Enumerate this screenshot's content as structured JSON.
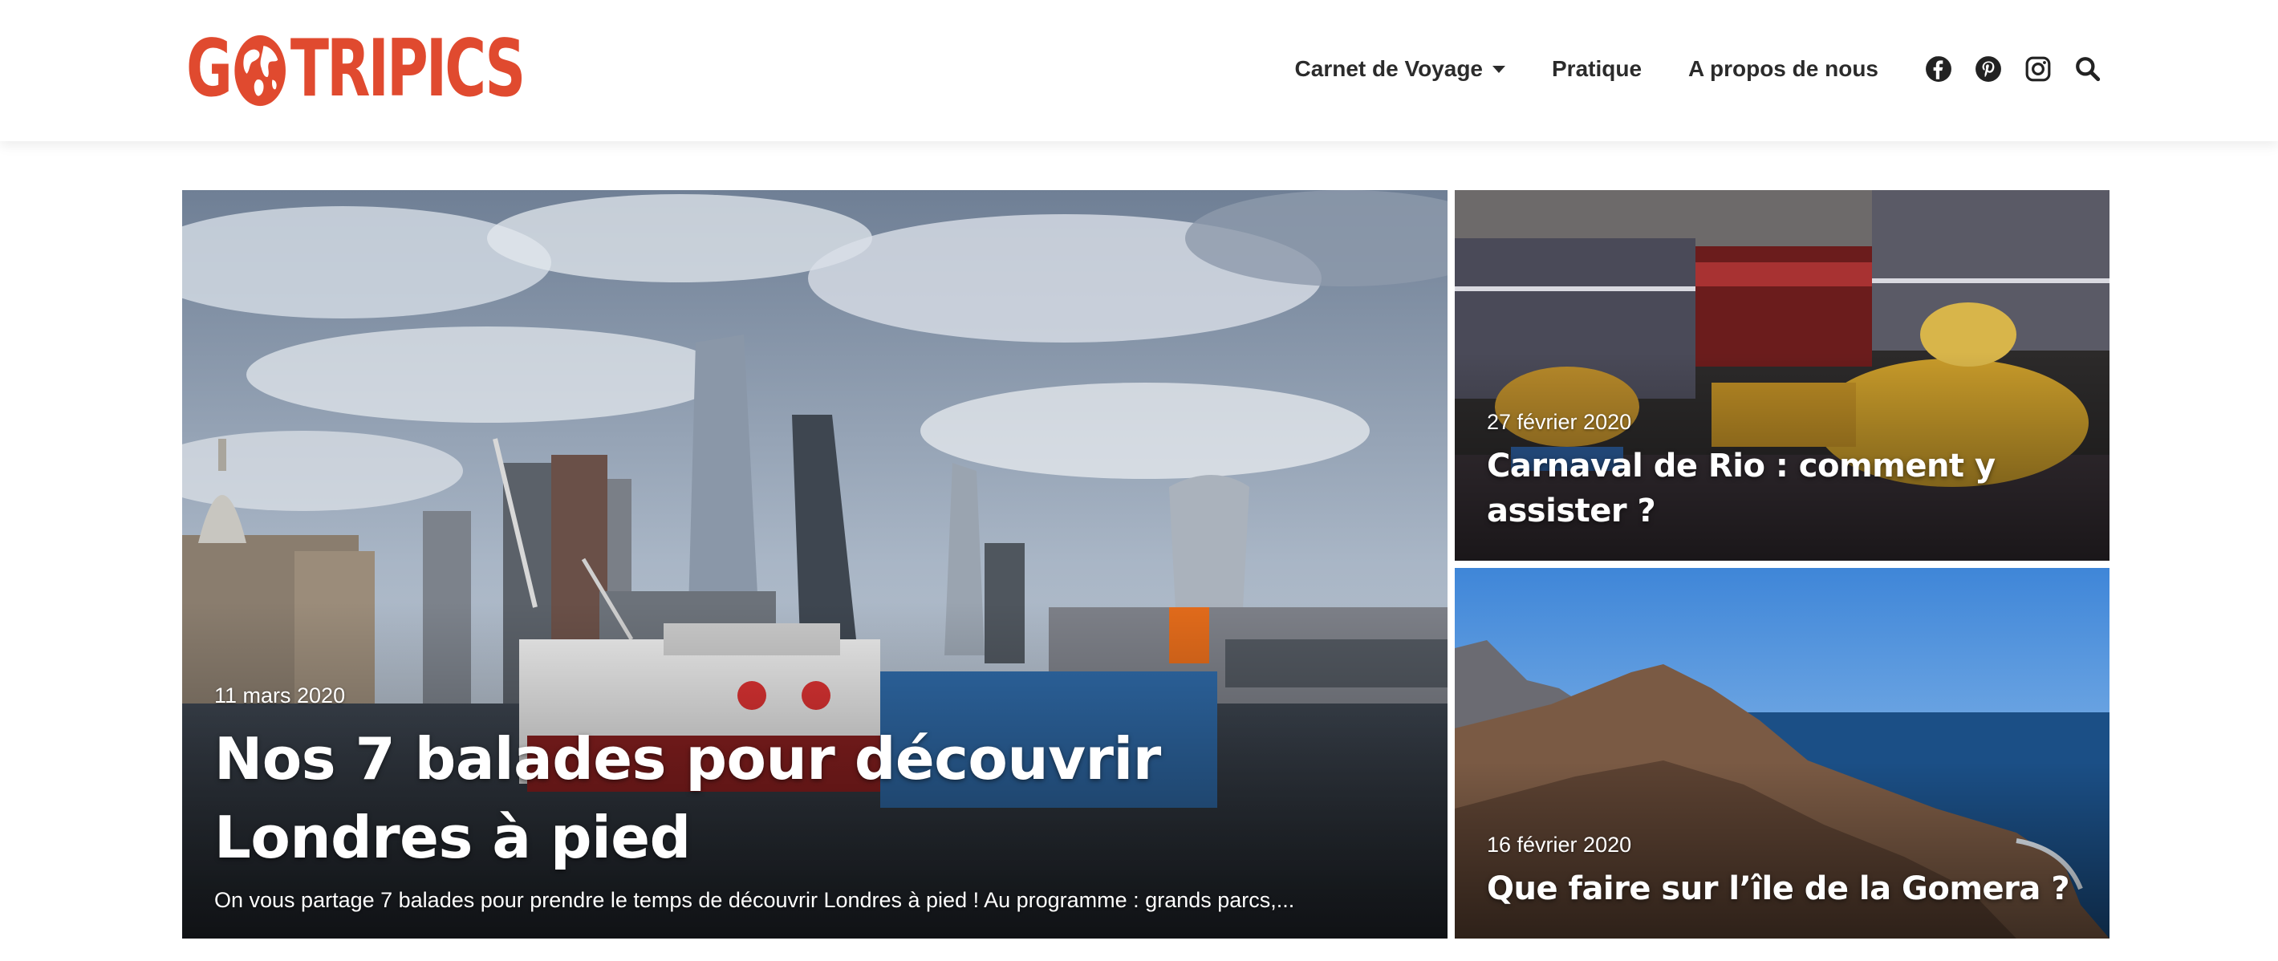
{
  "brand": {
    "logo_left": "G",
    "logo_right": "TRIPICS",
    "color": "#e04a2f",
    "logo_icon": "globe-icon"
  },
  "nav": {
    "items": [
      {
        "label": "Carnet de Voyage",
        "has_dropdown": true
      },
      {
        "label": "Pratique"
      },
      {
        "label": "A propos de nous"
      }
    ],
    "icons": [
      "facebook-icon",
      "pinterest-icon",
      "instagram-icon",
      "search-icon"
    ]
  },
  "articles": {
    "featured": {
      "date": "11 mars 2020",
      "title": "Nos 7 balades pour découvrir Londres à pied",
      "excerpt": "On vous partage 7 balades pour prendre le temps de découvrir Londres à pied ! Au programme : grands parcs,..."
    },
    "rio": {
      "date": "27 février 2020",
      "title": "Carnaval de Rio : comment y assister ?"
    },
    "gomera": {
      "date": "16 février 2020",
      "title": "Que faire sur l’île de la Gomera ?"
    }
  }
}
